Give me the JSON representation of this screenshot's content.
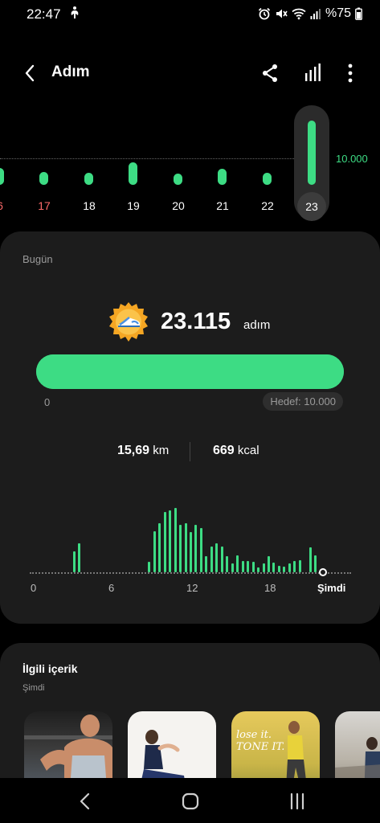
{
  "status_bar": {
    "time": "22:47",
    "battery": "%75",
    "icons": [
      "accessibility-icon",
      "alarm-icon",
      "mute-icon",
      "wifi-icon",
      "signal-icon",
      "battery-icon"
    ]
  },
  "app_bar": {
    "title": "Adım",
    "back_icon": "back-arrow-icon",
    "actions": [
      "share-icon",
      "bar-chart-icon",
      "more-vert-icon"
    ]
  },
  "day_chart": {
    "goal_label": "10.000",
    "goal": 10000,
    "days": [
      {
        "label": "6",
        "steps": 6500,
        "weekend": true,
        "selected": false
      },
      {
        "label": "17",
        "steps": 4900,
        "weekend": true,
        "selected": false
      },
      {
        "label": "18",
        "steps": 4600,
        "weekend": false,
        "selected": false
      },
      {
        "label": "19",
        "steps": 8400,
        "weekend": false,
        "selected": false
      },
      {
        "label": "20",
        "steps": 4300,
        "weekend": false,
        "selected": false
      },
      {
        "label": "21",
        "steps": 6000,
        "weekend": false,
        "selected": false
      },
      {
        "label": "22",
        "steps": 4400,
        "weekend": false,
        "selected": false
      },
      {
        "label": "23",
        "steps": 23115,
        "weekend": false,
        "selected": true
      }
    ]
  },
  "today_card": {
    "heading": "Bugün",
    "medal_icon": "shoe-medal-icon",
    "steps_value": "23.115",
    "steps_unit": "adım",
    "progress_fraction": 1.0,
    "progress_start": "0",
    "goal_text": "Hedef: 10.000",
    "distance_value": "15,69",
    "distance_unit": "km",
    "calories_value": "669",
    "calories_unit": "kcal"
  },
  "hourly_chart": {
    "ticks": [
      {
        "label": "0",
        "hour": 0,
        "now": false
      },
      {
        "label": "6",
        "hour": 6,
        "now": false
      },
      {
        "label": "12",
        "hour": 12,
        "now": false
      },
      {
        "label": "18",
        "hour": 18,
        "now": false
      },
      {
        "label": "Şimdi",
        "hour": 22.8,
        "now": true
      }
    ],
    "bars": [
      {
        "hour": 3.0,
        "steps": 260
      },
      {
        "hour": 3.4,
        "steps": 360
      },
      {
        "hour": 8.8,
        "steps": 130
      },
      {
        "hour": 9.2,
        "steps": 520
      },
      {
        "hour": 9.6,
        "steps": 620
      },
      {
        "hour": 10.0,
        "steps": 760
      },
      {
        "hour": 10.4,
        "steps": 780
      },
      {
        "hour": 10.8,
        "steps": 810
      },
      {
        "hour": 11.2,
        "steps": 600
      },
      {
        "hour": 11.6,
        "steps": 620
      },
      {
        "hour": 12.0,
        "steps": 510
      },
      {
        "hour": 12.4,
        "steps": 600
      },
      {
        "hour": 12.8,
        "steps": 560
      },
      {
        "hour": 13.2,
        "steps": 200
      },
      {
        "hour": 13.6,
        "steps": 320
      },
      {
        "hour": 14.0,
        "steps": 360
      },
      {
        "hour": 14.4,
        "steps": 320
      },
      {
        "hour": 14.8,
        "steps": 200
      },
      {
        "hour": 15.2,
        "steps": 110
      },
      {
        "hour": 15.6,
        "steps": 210
      },
      {
        "hour": 16.0,
        "steps": 140
      },
      {
        "hour": 16.4,
        "steps": 140
      },
      {
        "hour": 16.8,
        "steps": 130
      },
      {
        "hour": 17.2,
        "steps": 60
      },
      {
        "hour": 17.6,
        "steps": 110
      },
      {
        "hour": 18.0,
        "steps": 200
      },
      {
        "hour": 18.4,
        "steps": 120
      },
      {
        "hour": 18.8,
        "steps": 80
      },
      {
        "hour": 19.2,
        "steps": 70
      },
      {
        "hour": 19.6,
        "steps": 110
      },
      {
        "hour": 20.0,
        "steps": 140
      },
      {
        "hour": 20.4,
        "steps": 150
      },
      {
        "hour": 21.2,
        "steps": 310
      },
      {
        "hour": 21.6,
        "steps": 210
      }
    ]
  },
  "related": {
    "title": "İlgili içerik",
    "subtitle": "Şimdi",
    "thumb3_text": "lose it.\nTONE IT.",
    "items": [
      "workout-thumbnail-1",
      "workout-thumbnail-2",
      "workout-thumbnail-3",
      "workout-thumbnail-4"
    ]
  },
  "nav_bar": {
    "buttons": [
      "nav-back-icon",
      "nav-home-icon",
      "nav-recents-icon"
    ]
  }
}
